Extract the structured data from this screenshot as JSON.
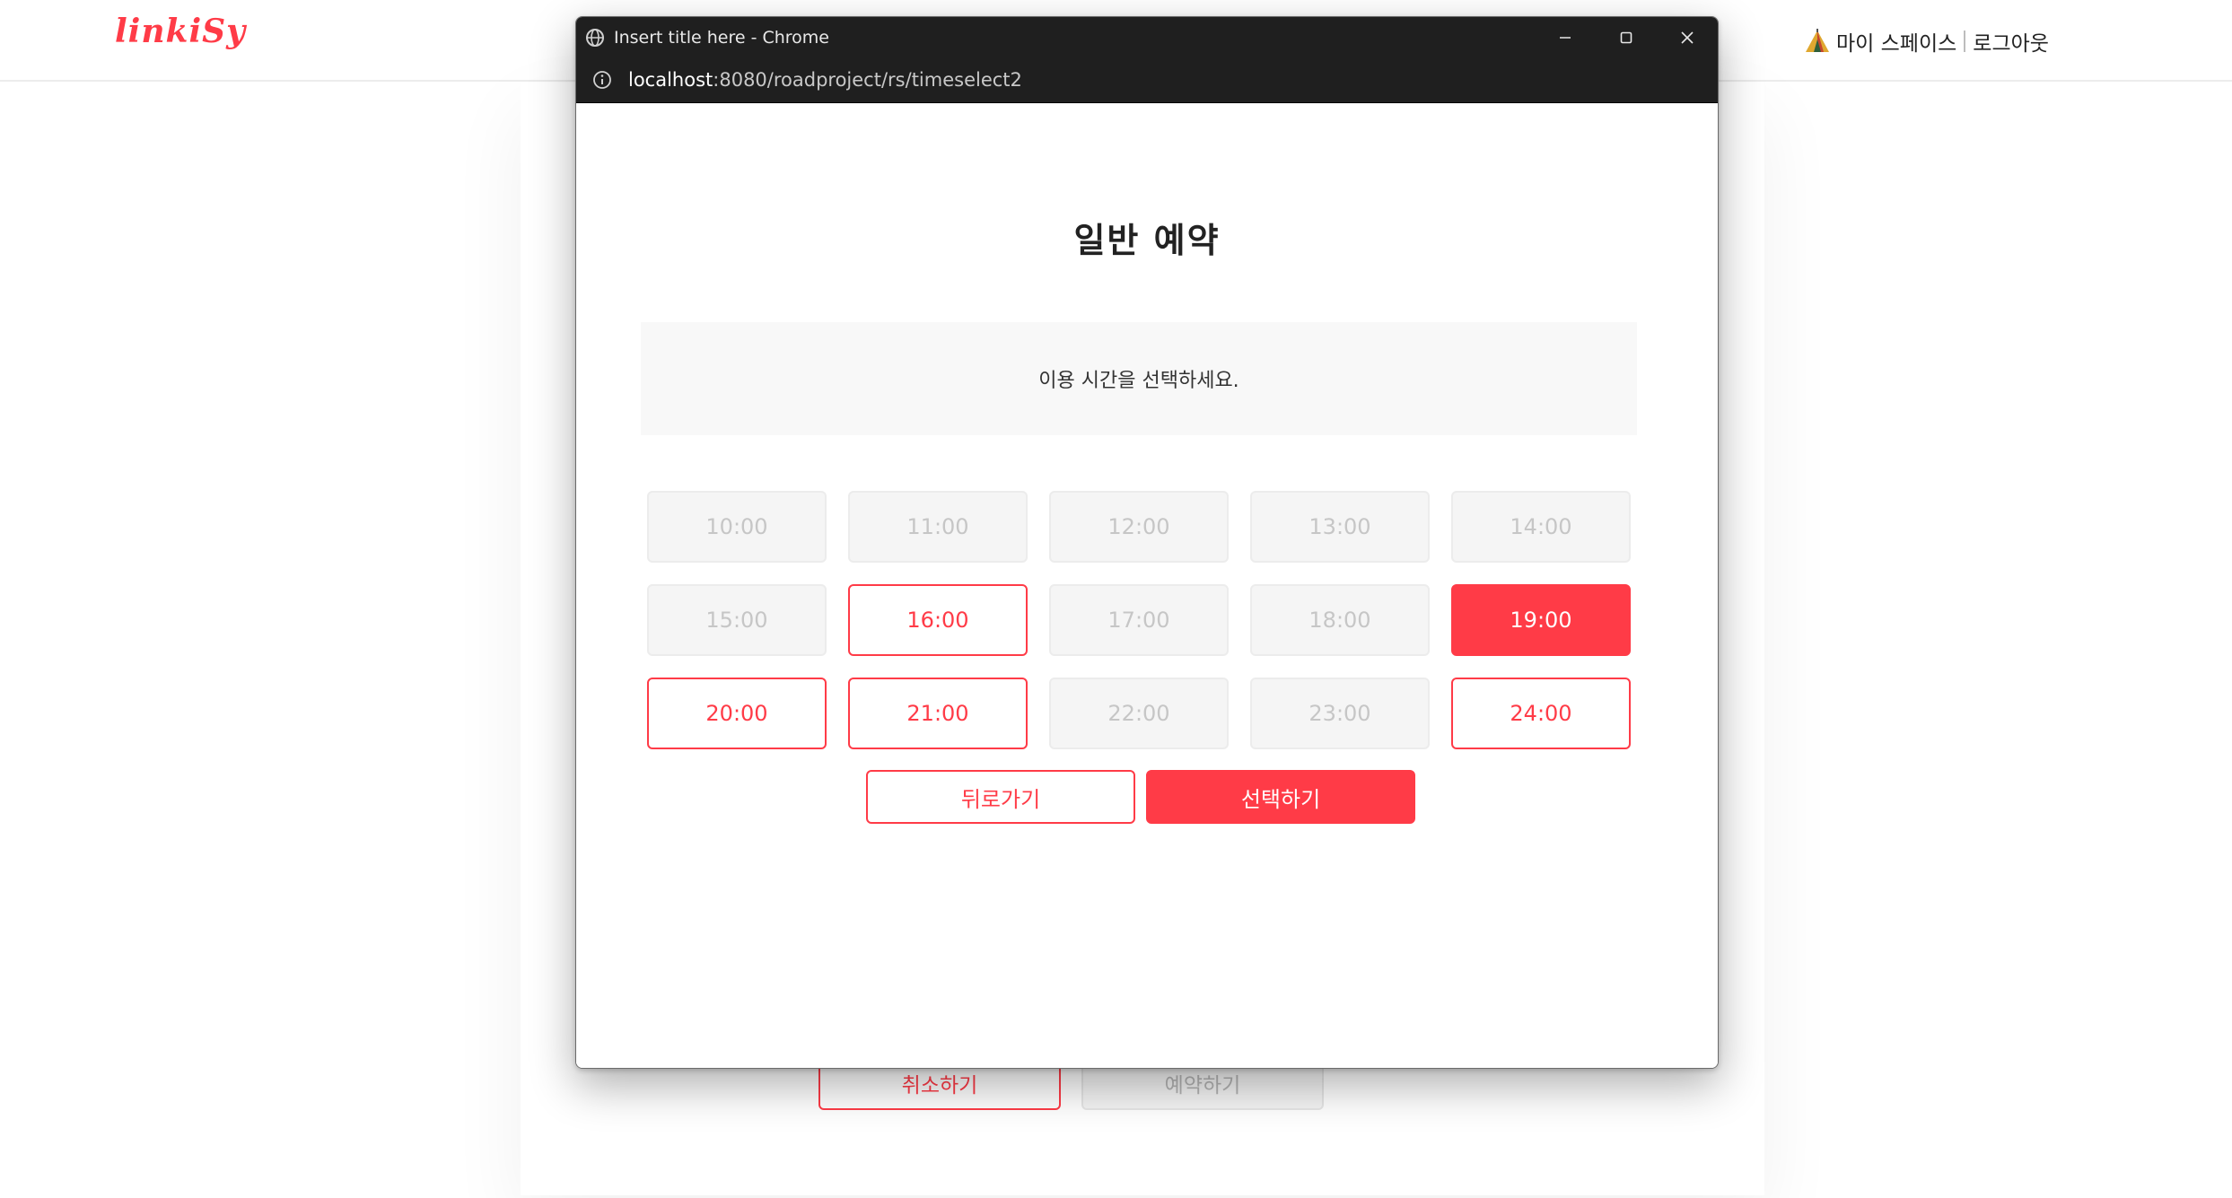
{
  "site": {
    "logo": "linkiSy",
    "nav": {
      "my_space": "마이 스페이스",
      "logout": "로그아웃"
    }
  },
  "background_page": {
    "cancel_label": "취소하기",
    "reserve_label": "예약하기"
  },
  "window": {
    "title": "Insert title here - Chrome",
    "url_host": "localhost",
    "url_rest": ":8080/roadproject/rs/timeselect2"
  },
  "dialog": {
    "heading": "일반 예약",
    "instruction": "이용 시간을 선택하세요.",
    "slots": [
      {
        "time": "10:00",
        "state": "disabled"
      },
      {
        "time": "11:00",
        "state": "disabled"
      },
      {
        "time": "12:00",
        "state": "disabled"
      },
      {
        "time": "13:00",
        "state": "disabled"
      },
      {
        "time": "14:00",
        "state": "disabled"
      },
      {
        "time": "15:00",
        "state": "disabled"
      },
      {
        "time": "16:00",
        "state": "available"
      },
      {
        "time": "17:00",
        "state": "disabled"
      },
      {
        "time": "18:00",
        "state": "disabled"
      },
      {
        "time": "19:00",
        "state": "selected"
      },
      {
        "time": "20:00",
        "state": "available"
      },
      {
        "time": "21:00",
        "state": "available"
      },
      {
        "time": "22:00",
        "state": "disabled"
      },
      {
        "time": "23:00",
        "state": "disabled"
      },
      {
        "time": "24:00",
        "state": "available"
      }
    ],
    "back_label": "뒤로가기",
    "select_label": "선택하기"
  },
  "colors": {
    "accent": "#ff3b47",
    "disabled_bg": "#f5f5f5",
    "disabled_text": "#c6c6c6",
    "chrome_bar": "#1f1f1f"
  },
  "icons": {
    "tent": "tent-icon",
    "globe": "globe-icon",
    "info": "info-icon",
    "minimize": "minimize-icon",
    "maximize": "maximize-icon",
    "close": "close-icon"
  }
}
